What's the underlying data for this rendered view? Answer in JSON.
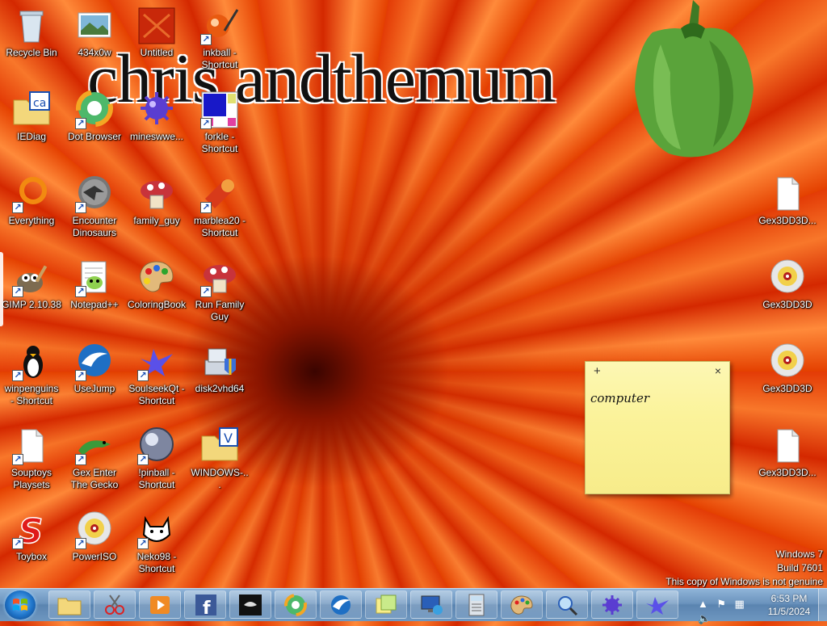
{
  "wallpaper_text": "chris andthemum",
  "icons": [
    {
      "name": "Recycle Bin",
      "icon": "recycle-bin-icon",
      "shortcut": false
    },
    {
      "name": "434x0w",
      "icon": "image-file-icon",
      "shortcut": false
    },
    {
      "name": "Untitled",
      "icon": "image-file-icon",
      "shortcut": false
    },
    {
      "name": "inkball - Shortcut",
      "icon": "inkball-icon",
      "shortcut": true
    },
    {
      "name": "IEDiag",
      "icon": "folder-icon",
      "shortcut": false
    },
    {
      "name": "Dot Browser",
      "icon": "dot-browser-icon",
      "shortcut": true
    },
    {
      "name": "mineswwe...",
      "icon": "minesweeper-icon",
      "shortcut": false
    },
    {
      "name": "forkle - Shortcut",
      "icon": "forkle-icon",
      "shortcut": true
    },
    {
      "name": "Everything",
      "icon": "everything-search-icon",
      "shortcut": true
    },
    {
      "name": "Encounter Dinosaurs",
      "icon": "dinosaur-icon",
      "shortcut": true
    },
    {
      "name": "family_guy",
      "icon": "mushroom-game-icon",
      "shortcut": false
    },
    {
      "name": "marblea20 - Shortcut",
      "icon": "marble-game-icon",
      "shortcut": true
    },
    {
      "name": "GIMP 2.10.38",
      "icon": "gimp-icon",
      "shortcut": true
    },
    {
      "name": "Notepad++",
      "icon": "notepad-plus-icon",
      "shortcut": true
    },
    {
      "name": "ColoringBook",
      "icon": "paint-palette-icon",
      "shortcut": false
    },
    {
      "name": "Run Family Guy",
      "icon": "mushroom-game-icon",
      "shortcut": true
    },
    {
      "name": "winpenguins - Shortcut",
      "icon": "penguin-icon",
      "shortcut": true
    },
    {
      "name": "UseJump",
      "icon": "jump-icon",
      "shortcut": true
    },
    {
      "name": "SoulseekQt - Shortcut",
      "icon": "soulseek-bird-icon",
      "shortcut": true
    },
    {
      "name": "disk2vhd64",
      "icon": "disk-installer-icon",
      "shortcut": false
    },
    {
      "name": "Souptoys Playsets",
      "icon": "blank-document-icon",
      "shortcut": true
    },
    {
      "name": "Gex Enter The Gecko",
      "icon": "gecko-icon",
      "shortcut": true
    },
    {
      "name": "!pinball - Shortcut",
      "icon": "pinball-icon",
      "shortcut": true
    },
    {
      "name": "WINDOWS-...",
      "icon": "folder-icon",
      "shortcut": false
    },
    {
      "name": "Toybox",
      "icon": "toybox-icon",
      "shortcut": true
    },
    {
      "name": "PowerISO",
      "icon": "disc-icon",
      "shortcut": true
    },
    {
      "name": "Neko98 - Shortcut",
      "icon": "neko-cat-icon",
      "shortcut": true
    }
  ],
  "right_icons": [
    {
      "name": "Gex3DD3D...",
      "icon": "blank-document-icon"
    },
    {
      "name": "Gex3DD3D",
      "icon": "disc-icon"
    },
    {
      "name": "Gex3DD3D",
      "icon": "disc-icon"
    },
    {
      "name": "Gex3DD3D...",
      "icon": "blank-document-icon"
    }
  ],
  "sticky_note": {
    "add": "+",
    "close": "×",
    "text": "computer"
  },
  "watermark": {
    "line1": "Windows 7",
    "line2": "Build 7601",
    "line3": "This copy of Windows is not genuine"
  },
  "taskbar": {
    "items": [
      "explorer",
      "snipping-tool",
      "media-player",
      "facebook",
      "dark-app",
      "dot-browser",
      "usejump",
      "sticky-notes",
      "remote-desktop",
      "calculator",
      "paint",
      "magnifier",
      "minesweeper",
      "soulseek"
    ]
  },
  "clock": {
    "time": "6:53 PM",
    "date": "11/5/2024"
  }
}
